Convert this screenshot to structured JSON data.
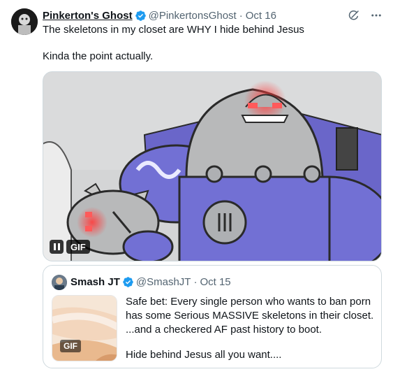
{
  "post": {
    "author_name": "Pinkerton's Ghost",
    "author_handle": "@PinkertonsGhost",
    "separator": "·",
    "date": "Oct 16",
    "text_line1": "The skeletons in my closet are WHY I hide behind Jesus",
    "text_line2": "Kinda the point actually.",
    "media_badge": "GIF",
    "icons": {
      "grok": "grok-icon",
      "more": "more-icon",
      "verified": "verified-badge-icon",
      "pause": "pause-icon"
    }
  },
  "quote": {
    "author_name": "Smash JT",
    "author_handle": "@SmashJT",
    "separator": "·",
    "date": "Oct 15",
    "thumb_badge": "GIF",
    "lines": [
      "Safe bet: Every single person who wants to ban porn",
      "has some Serious MASSIVE skeletons in their closet.",
      "...and a checkered AF past history to boot.",
      "Hide behind Jesus all you want...."
    ]
  },
  "colors": {
    "text": "#0f1419",
    "muted": "#536471",
    "verified": "#1d9bf0",
    "border": "#cfd9de"
  }
}
